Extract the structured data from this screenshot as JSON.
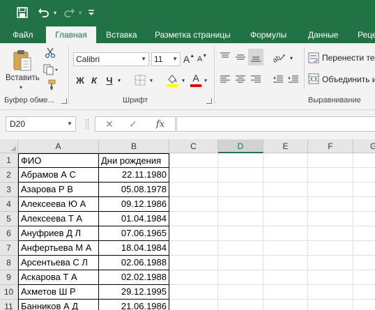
{
  "colors": {
    "brand": "#217346",
    "ribbon_bg": "#f3f3f3",
    "header_bg": "#e6e6e6"
  },
  "qat": {
    "save_icon": "save-icon",
    "undo_icon": "undo-icon",
    "redo_icon": "redo-icon",
    "customize_icon": "customize-qat-icon"
  },
  "tabs": [
    "Файл",
    "Главная",
    "Вставка",
    "Разметка страницы",
    "Формулы",
    "Данные",
    "Реце"
  ],
  "active_tab": "Главная",
  "ribbon": {
    "clipboard": {
      "paste_label": "Вставить",
      "group_label": "Буфер обме..."
    },
    "font": {
      "font_name": "Calibri",
      "font_size": "11",
      "bold": "Ж",
      "italic": "К",
      "underline": "Ч",
      "font_color_glyph": "А",
      "grow_glyph": "A",
      "shrink_glyph": "A",
      "group_label": "Шрифт"
    },
    "alignment": {
      "wrap_text": "Перенести тек",
      "merge": "Объединить и",
      "group_label": "Выравнивание"
    }
  },
  "formula_bar": {
    "name_box": "D20",
    "cancel": "✕",
    "enter": "✓",
    "fx": "fx",
    "formula": ""
  },
  "sheet": {
    "columns": [
      "A",
      "B",
      "C",
      "D",
      "E",
      "F",
      "G"
    ],
    "selected_column": "D",
    "rows": [
      {
        "num": "1",
        "a": "ФИО",
        "b": "Дни рождения"
      },
      {
        "num": "2",
        "a": "Абрамов А С",
        "b": "22.11.1980"
      },
      {
        "num": "3",
        "a": "Азарова Р В",
        "b": "05.08.1978"
      },
      {
        "num": "4",
        "a": "Алексеева Ю А",
        "b": "09.12.1986"
      },
      {
        "num": "5",
        "a": "Алексеева Т А",
        "b": "01.04.1984"
      },
      {
        "num": "6",
        "a": "Ануфриев Д Л",
        "b": "07.06.1965"
      },
      {
        "num": "7",
        "a": "Анфертьева М А",
        "b": "18.04.1984"
      },
      {
        "num": "8",
        "a": "Арсентьева С Л",
        "b": "02.06.1988"
      },
      {
        "num": "9",
        "a": "Аскарова Т А",
        "b": "02.02.1988"
      },
      {
        "num": "10",
        "a": "Ахметов Ш Р",
        "b": "29.12.1995"
      },
      {
        "num": "11",
        "a": "Банников А Д",
        "b": "21.06.1986"
      }
    ]
  }
}
